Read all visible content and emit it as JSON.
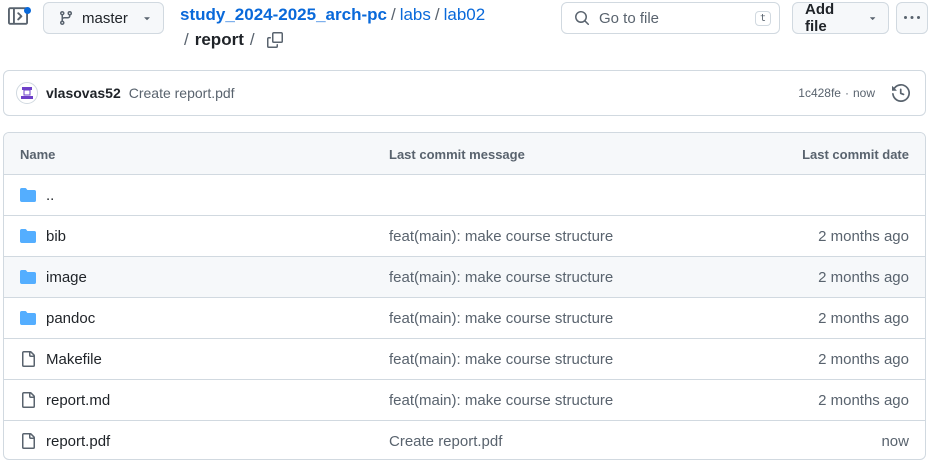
{
  "toolbar": {
    "branch": "master",
    "search_placeholder": "Go to file",
    "search_shortcut": "t",
    "add_file_label": "Add file"
  },
  "breadcrumb": {
    "repo": "study_2024-2025_arch-pc",
    "separator": "/",
    "path_1": "labs",
    "path_2": "lab02",
    "current": "report"
  },
  "latest_commit": {
    "author": "vlasovas52",
    "message": "Create report.pdf",
    "sha": "1c428fe",
    "dot": "·",
    "time": "now"
  },
  "table": {
    "headers": {
      "name": "Name",
      "message": "Last commit message",
      "date": "Last commit date"
    },
    "rows": [
      {
        "name": "..",
        "type": "folder",
        "message": "",
        "date": ""
      },
      {
        "name": "bib",
        "type": "folder",
        "message": "feat(main): make course structure",
        "date": "2 months ago"
      },
      {
        "name": "image",
        "type": "folder",
        "message": "feat(main): make course structure",
        "date": "2 months ago"
      },
      {
        "name": "pandoc",
        "type": "folder",
        "message": "feat(main): make course structure",
        "date": "2 months ago"
      },
      {
        "name": "Makefile",
        "type": "file",
        "message": "feat(main): make course structure",
        "date": "2 months ago"
      },
      {
        "name": "report.md",
        "type": "file",
        "message": "feat(main): make course structure",
        "date": "2 months ago"
      },
      {
        "name": "report.pdf",
        "type": "file",
        "message": "Create report.pdf",
        "date": "now"
      }
    ]
  },
  "colors": {
    "link": "#0969da",
    "folder": "#54aeff",
    "muted": "#59636e",
    "border": "#d1d9e0",
    "avatar_accent": "#6e40c9"
  },
  "icons": {
    "sidebar": "sidebar-expand-icon",
    "branch": "git-branch-icon",
    "search": "search-icon",
    "copy": "copy-icon",
    "more": "kebab-horizontal-icon",
    "history": "history-icon",
    "folder": "folder-icon",
    "file": "file-icon"
  }
}
